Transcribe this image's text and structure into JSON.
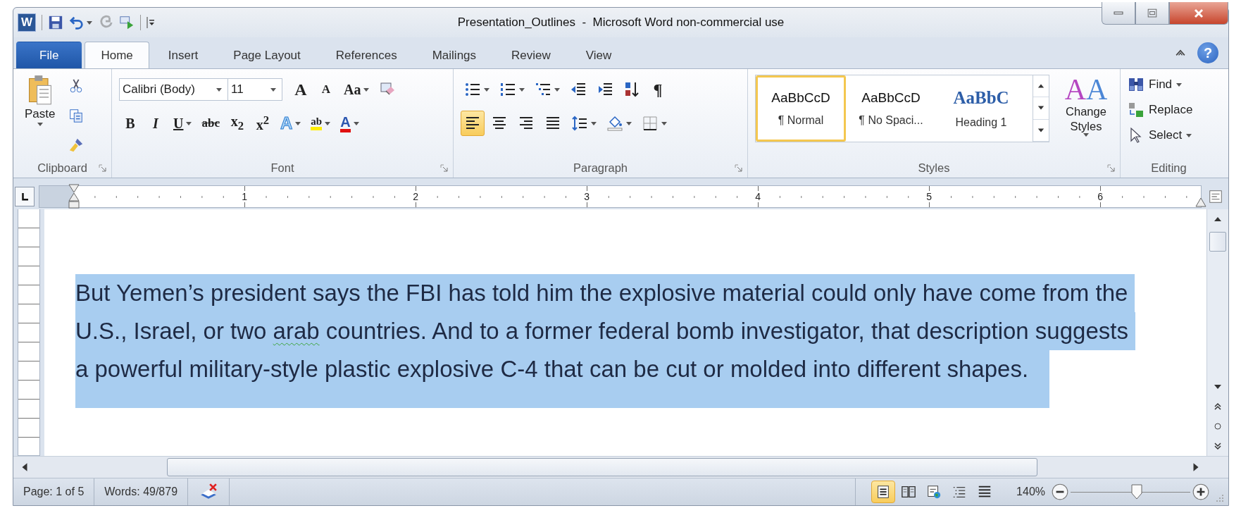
{
  "window": {
    "logo": "W",
    "title": "Presentation_Outlines  -  Microsoft Word non-commercial use",
    "help": "?"
  },
  "quick_access": [
    {
      "kind": "save",
      "caret": false,
      "disabled": false
    },
    {
      "kind": "undo",
      "caret": true,
      "disabled": false
    },
    {
      "kind": "redo",
      "caret": false,
      "disabled": true
    },
    {
      "kind": "send",
      "caret": false,
      "disabled": false
    }
  ],
  "tabs": [
    {
      "label": "File",
      "kind": "file",
      "selected": false
    },
    {
      "label": "Home",
      "kind": "tab",
      "selected": true
    },
    {
      "label": "Insert",
      "kind": "tab",
      "selected": false
    },
    {
      "label": "Page Layout",
      "kind": "tab",
      "selected": false
    },
    {
      "label": "References",
      "kind": "tab",
      "selected": false
    },
    {
      "label": "Mailings",
      "kind": "tab",
      "selected": false
    },
    {
      "label": "Review",
      "kind": "tab",
      "selected": false
    },
    {
      "label": "View",
      "kind": "tab",
      "selected": false
    }
  ],
  "clipboard": {
    "paste_label": "Paste",
    "group_label": "Clipboard"
  },
  "font": {
    "name": "Calibri (Body)",
    "size": "11",
    "group_label": "Font",
    "row1": [
      {
        "kind": "grow",
        "glyph": "A",
        "caret": false
      },
      {
        "kind": "shrink",
        "glyph": "A",
        "caret": false
      },
      {
        "kind": "case",
        "glyph": "Aa",
        "caret": true
      },
      {
        "kind": "clear",
        "caret": false
      }
    ],
    "row2": [
      {
        "kind": "bold",
        "glyph": "B",
        "caret": false
      },
      {
        "kind": "italic",
        "glyph": "I",
        "caret": false
      },
      {
        "kind": "underline",
        "glyph": "U",
        "caret": true
      },
      {
        "kind": "strike",
        "glyph": "abc",
        "caret": false
      },
      {
        "kind": "sub",
        "glyph": "x$_{2}$",
        "caret": false
      },
      {
        "kind": "sup",
        "glyph": "x$^{2}$",
        "caret": false
      },
      {
        "kind": "effects",
        "glyph": "A",
        "caret": true
      },
      {
        "kind": "highlight",
        "glyph": "ab",
        "caret": true
      },
      {
        "kind": "color",
        "glyph": "A",
        "caret": true
      }
    ]
  },
  "paragraph": {
    "group_label": "Paragraph",
    "row1": [
      {
        "kind": "bullets",
        "caret": true
      },
      {
        "kind": "numbering",
        "caret": true
      },
      {
        "kind": "multilevel",
        "caret": true
      },
      {
        "kind": "outdent",
        "caret": false
      },
      {
        "kind": "indent",
        "caret": false
      },
      {
        "kind": "sort",
        "caret": false
      },
      {
        "kind": "marks",
        "glyph": "¶",
        "caret": false
      }
    ],
    "row2": [
      {
        "kind": "align_left",
        "selected": true
      },
      {
        "kind": "align_center",
        "selected": false
      },
      {
        "kind": "align_right",
        "selected": false
      },
      {
        "kind": "justify",
        "selected": false
      },
      {
        "kind": "spacing",
        "caret": true
      },
      {
        "kind": "shading",
        "caret": true
      },
      {
        "kind": "borders",
        "caret": true
      }
    ]
  },
  "styles": {
    "group_label": "Styles",
    "change_glyph": "AA",
    "change_label": "Change Styles",
    "gallery": [
      {
        "preview": "AaBbCcD",
        "name": "¶ Normal",
        "kind": "body",
        "selected": true
      },
      {
        "preview": "AaBbCcD",
        "name": "¶ No Spaci...",
        "kind": "body",
        "selected": false
      },
      {
        "preview": "AaBbC",
        "name": "Heading 1",
        "kind": "heading",
        "selected": false
      }
    ]
  },
  "editing": {
    "group_label": "Editing",
    "items": [
      {
        "label": "Find",
        "kind": "find",
        "caret": true
      },
      {
        "label": "Replace",
        "kind": "replace",
        "caret": false
      },
      {
        "label": "Select",
        "kind": "select",
        "caret": true
      }
    ]
  },
  "ruler": {
    "numbers": [
      "1",
      "2",
      "3",
      "4",
      "5",
      "6"
    ]
  },
  "document": {
    "selected": true,
    "lines": [
      [
        {
          "text": "But Yemen’s president says the FBI has told him the explosive material could only have come from the",
          "misspelled": false
        }
      ],
      [
        {
          "text": "U.S., Israel, or two ",
          "misspelled": false
        },
        {
          "text": "arab",
          "misspelled": true
        },
        {
          "text": " countries. And to a former federal bomb investigator, that description suggests",
          "misspelled": false
        }
      ],
      [
        {
          "text": "a powerful military-style plastic explosive C-4 that can be cut or molded into different shapes.",
          "misspelled": false
        }
      ]
    ]
  },
  "status_bar": {
    "page": "Page: 1 of 5",
    "words": "Words: 49/879",
    "zoom": "140%",
    "zoom_slider": {
      "level": 0.55
    },
    "views": [
      {
        "kind": "print",
        "selected": true
      },
      {
        "kind": "reading",
        "selected": false
      },
      {
        "kind": "web",
        "selected": false
      },
      {
        "kind": "outline",
        "selected": false
      },
      {
        "kind": "draft",
        "selected": false
      }
    ]
  }
}
